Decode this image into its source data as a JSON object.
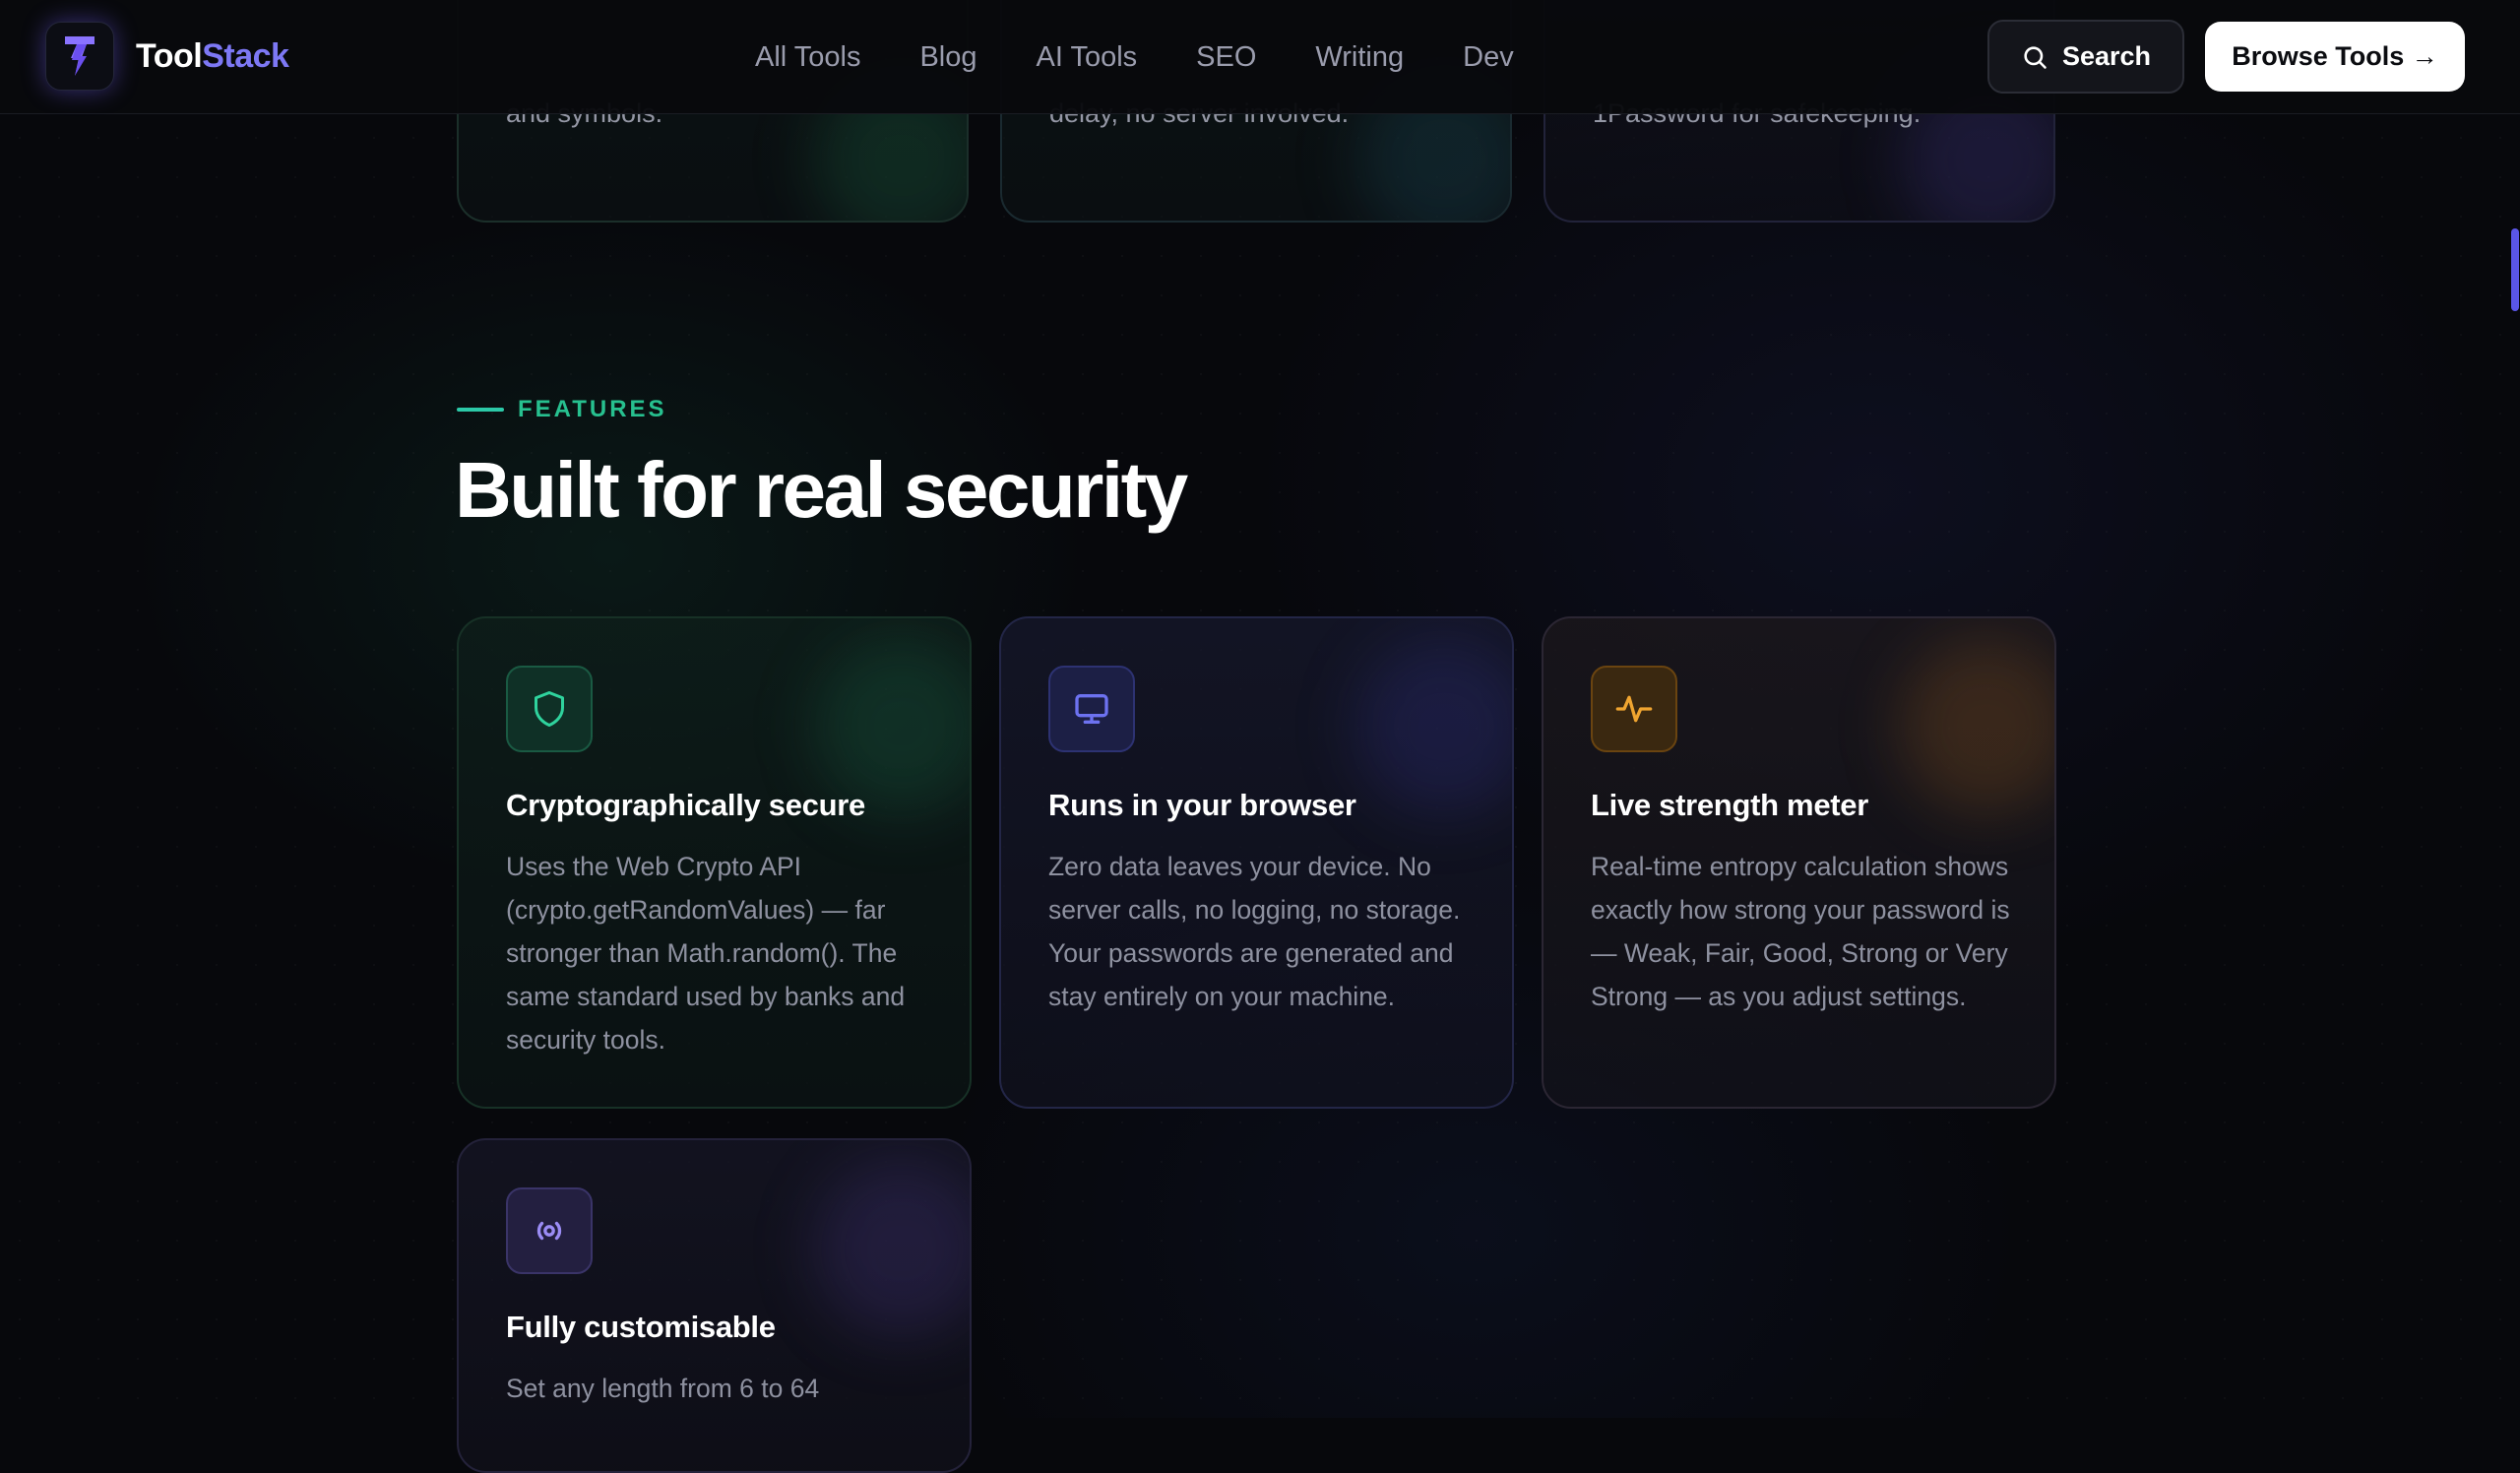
{
  "header": {
    "brand_a": "Tool",
    "brand_b": "Stack",
    "nav": [
      "All Tools",
      "Blog",
      "AI Tools",
      "SEO",
      "Writing",
      "Dev"
    ],
    "search_label": "Search",
    "browse_label": "Browse Tools →"
  },
  "top_cards": [
    {
      "text": "and symbols."
    },
    {
      "text": "delay, no server involved."
    },
    {
      "text": "1Password for safekeeping."
    }
  ],
  "features": {
    "eyebrow": "FEATURES",
    "heading": "Built for real security",
    "cards": [
      {
        "icon": "shield-icon",
        "title": "Cryptographically secure",
        "desc": "Uses the Web Crypto API (crypto.getRandomValues) — far stronger than Math.random(). The same standard used by banks and security tools."
      },
      {
        "icon": "monitor-icon",
        "title": "Runs in your browser",
        "desc": "Zero data leaves your device. No server calls, no logging, no storage. Your passwords are generated and stay entirely on your machine."
      },
      {
        "icon": "activity-icon",
        "title": "Live strength meter",
        "desc": "Real-time entropy calculation shows exactly how strong your password is — Weak, Fair, Good, Strong or Very Strong — as you adjust settings."
      },
      {
        "icon": "broadcast-icon",
        "title": "Fully customisable",
        "desc": "Set any length from 6 to 64"
      }
    ]
  },
  "colors": {
    "accent_green": "#27c08f",
    "accent_indigo": "#7d78f5",
    "accent_amber": "#e0a033"
  }
}
